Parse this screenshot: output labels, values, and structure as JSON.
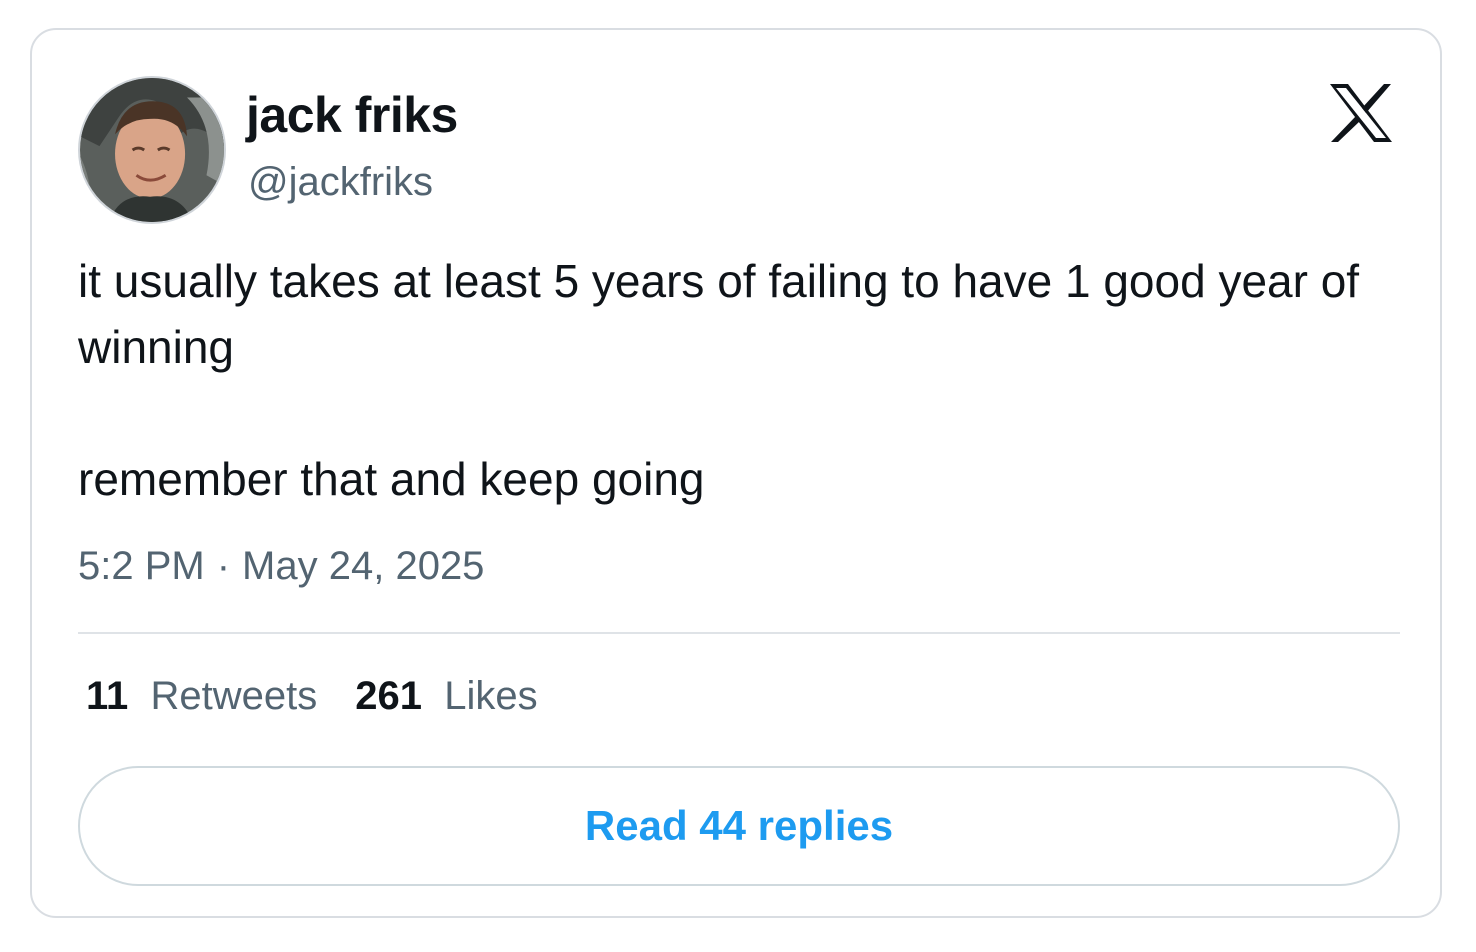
{
  "tweet": {
    "author": {
      "display_name": "jack friks",
      "handle": "@jackfriks",
      "avatar": "user-photo"
    },
    "platform_icon": "x-logo-icon",
    "text": {
      "paragraph_1": "it usually takes at least 5 years of failing to have 1 good year of winning",
      "paragraph_2": "remember that and keep going"
    },
    "time": "5:2 PM",
    "separator": "·",
    "date": "May 24, 2025",
    "stats": {
      "retweets_count": "11",
      "retweets_label": "Retweets",
      "likes_count": "261",
      "likes_label": "Likes"
    },
    "read_replies_label": "Read 44 replies"
  },
  "colors": {
    "text_primary": "#0f1419",
    "text_secondary": "#536471",
    "accent": "#1d9bf0",
    "border": "#d9dde2"
  }
}
